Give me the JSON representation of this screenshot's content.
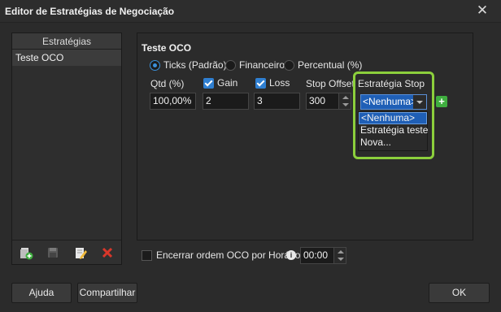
{
  "window": {
    "title": "Editor de Estratégias de Negociação",
    "close_glyph": "✕"
  },
  "sidebar": {
    "header": "Estratégias",
    "items": [
      {
        "label": "Teste OCO",
        "selected": true
      }
    ],
    "tools": [
      "add-strategy-icon",
      "save-icon",
      "edit-icon",
      "delete-icon"
    ]
  },
  "strategy": {
    "name": "Teste OCO",
    "mode_options": [
      {
        "label": "Ticks (Padrão)",
        "selected": true
      },
      {
        "label": "Financeiro",
        "selected": false
      },
      {
        "label": "Percentual (%)",
        "selected": false
      }
    ],
    "columns": {
      "qtd": "Qtd (%)",
      "gain": "Gain",
      "loss": "Loss",
      "stop_offset": "Stop Offset",
      "estrategia_stop": "Estratégia Stop"
    },
    "values": {
      "qtd": "100,00%",
      "gain": "2",
      "loss": "3",
      "stop_offset": "300",
      "estrategia_stop": "<Nenhuma>"
    },
    "gain_checked": true,
    "loss_checked": true,
    "dropdown_options": [
      "<Nenhuma>",
      "Estratégia teste",
      "Nova..."
    ],
    "dropdown_selected": "<Nenhuma>",
    "add_glyph": "+"
  },
  "footer": {
    "encerrar_label": "Encerrar ordem OCO por Horário",
    "encerrar_checked": false,
    "time": "00:00",
    "info_glyph": "i"
  },
  "buttons": {
    "ajuda": "Ajuda",
    "compartilhar": "Compartilhar",
    "ok": "OK"
  },
  "colors": {
    "accent": "#1f5fb6",
    "highlight": "#8ccf3c",
    "add": "#3fae3f",
    "delete": "#d9372a"
  }
}
